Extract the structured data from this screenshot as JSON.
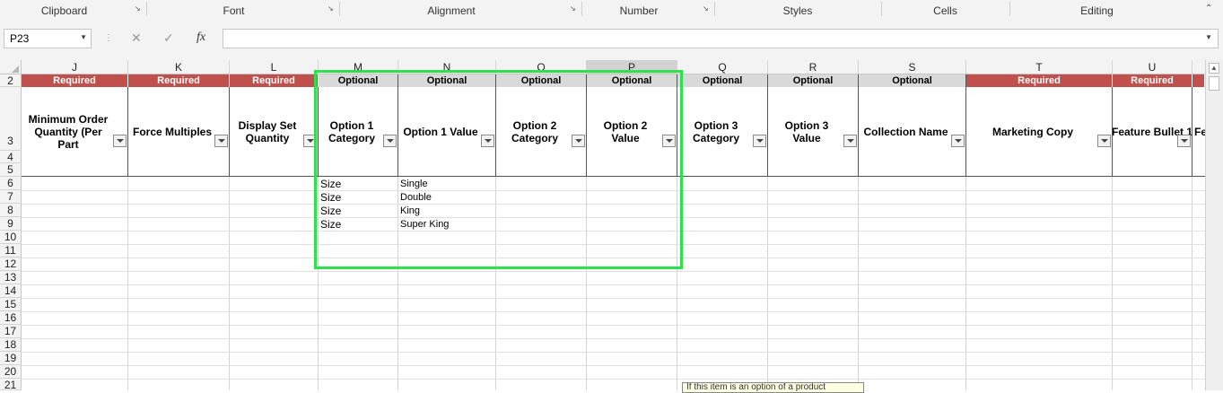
{
  "ribbon": {
    "groups": [
      "Clipboard",
      "Font",
      "Alignment",
      "Number",
      "Styles",
      "Cells",
      "Editing"
    ]
  },
  "formula_bar": {
    "name_box": "P23",
    "cancel_icon": "close-icon",
    "enter_icon": "check-icon",
    "function_label": "fx",
    "formula": ""
  },
  "sheet": {
    "columns": [
      "J",
      "K",
      "L",
      "M",
      "N",
      "O",
      "P",
      "Q",
      "R",
      "S",
      "T",
      "U"
    ],
    "selected_column": "P",
    "rows": [
      "2",
      "3",
      "4",
      "5",
      "6",
      "7",
      "8",
      "9",
      "10",
      "11",
      "12",
      "13",
      "14",
      "15",
      "16",
      "17",
      "18",
      "19",
      "20",
      "21"
    ],
    "row2_tags": [
      "Required",
      "Required",
      "Required",
      "Optional",
      "Optional",
      "Optional",
      "Optional",
      "Optional",
      "Optional",
      "Optional",
      "Required",
      "Required"
    ],
    "headers": [
      "Minimum Order Quantity (Per Part",
      "Force Multiples",
      "Display Set Quantity",
      "Option 1 Category",
      "Option 1 Value",
      "Option 2 Category",
      "Option 2 Value",
      "Option 3 Category",
      "Option 3 Value",
      "Collection Name",
      "Marketing Copy",
      "Feature Bullet 1"
    ],
    "overflow_header": "Fe",
    "data_rows": [
      {
        "row": "6",
        "option1_category": "Size",
        "option1_value": "Single"
      },
      {
        "row": "7",
        "option1_category": "Size",
        "option1_value": "Double"
      },
      {
        "row": "8",
        "option1_category": "Size",
        "option1_value": "King"
      },
      {
        "row": "9",
        "option1_category": "Size",
        "option1_value": "Super King"
      }
    ]
  },
  "tooltip_text": "If this item is an option of a product",
  "colors": {
    "required": "#c0504d",
    "optional": "#d9d9d9",
    "highlight": "#2ee04a"
  }
}
